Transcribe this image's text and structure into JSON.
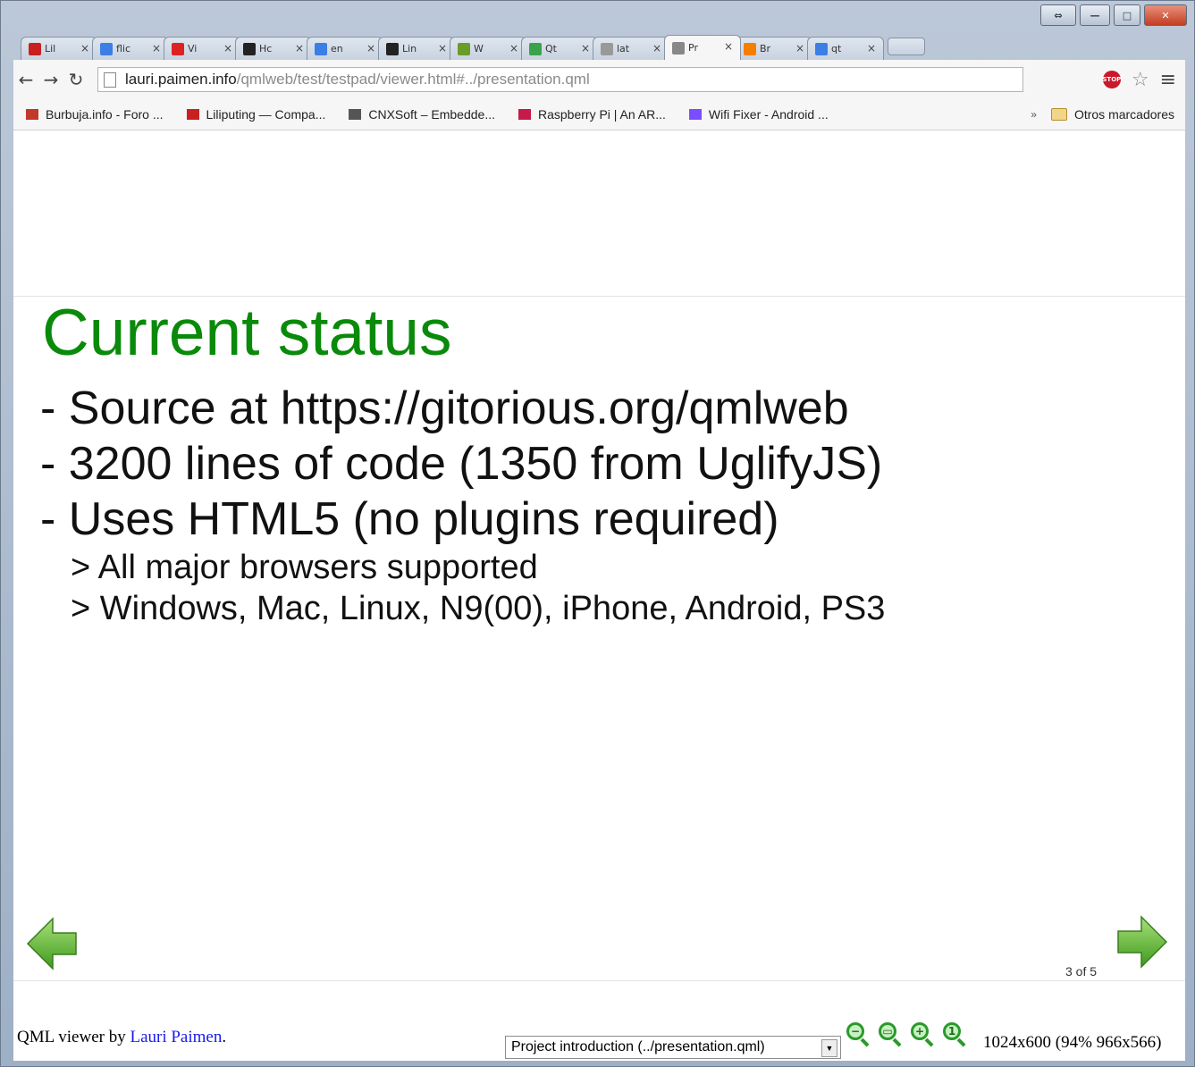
{
  "browser": {
    "tabs": [
      {
        "label": "Lil",
        "icon": "laptop-icon",
        "color": "#c8201e"
      },
      {
        "label": "flic",
        "icon": "google-plus-icon",
        "color": "#3a7ee6"
      },
      {
        "label": "Vi",
        "icon": "arc-icon",
        "color": "#d22"
      },
      {
        "label": "Hc",
        "icon": "github-icon",
        "color": "#222"
      },
      {
        "label": "en",
        "icon": "google-plus-icon",
        "color": "#3a7ee6"
      },
      {
        "label": "Lin",
        "icon": "github-icon",
        "color": "#222"
      },
      {
        "label": "W",
        "icon": "webos-icon",
        "color": "#6a9c28"
      },
      {
        "label": "Qt",
        "icon": "plus-box-icon",
        "color": "#3aa34a"
      },
      {
        "label": "lat",
        "icon": "spinner-icon",
        "color": "#999"
      },
      {
        "label": "Pr",
        "icon": "page-icon",
        "color": "#888",
        "active": true
      },
      {
        "label": "Br",
        "icon": "blogger-icon",
        "color": "#f57d00"
      },
      {
        "label": "qt",
        "icon": "google-plus-icon",
        "color": "#3a7ee6"
      }
    ],
    "url_host": "lauri.paimen.info",
    "url_path": "/qmlweb/test/testpad/viewer.html#../presentation.qml",
    "bookmarks": [
      {
        "label": "Burbuja.info - Foro ...",
        "icon": "burbuja-icon",
        "color": "#c0392b"
      },
      {
        "label": "Liliputing — Compa...",
        "icon": "laptop-icon",
        "color": "#c8201e"
      },
      {
        "label": "CNXSoft – Embedde...",
        "icon": "cnx-icon",
        "color": "#555"
      },
      {
        "label": "Raspberry Pi | An AR...",
        "icon": "raspberry-icon",
        "color": "#c51a4a"
      },
      {
        "label": "Wifi Fixer - Android ...",
        "icon": "play-store-icon",
        "color": "#7c4dff"
      }
    ],
    "bookmarks_overflow": "»",
    "other_bookmarks": "Otros marcadores",
    "stop_label": "STOP"
  },
  "slide": {
    "title": "Current status",
    "bullets": [
      "- Source at https://gitorious.org/qmlweb",
      "- 3200 lines of code (1350 from UglifyJS)",
      "- Uses HTML5 (no plugins required)"
    ],
    "subbullets": [
      "> All major browsers supported",
      "> Windows, Mac, Linux, N9(00), iPhone, Android, PS3"
    ],
    "counter": "3 of 5"
  },
  "footer": {
    "credit_prefix": "QML viewer by ",
    "credit_link": "Lauri Paimen",
    "credit_suffix": ".",
    "presentation_select": "Project introduction (../presentation.qml)",
    "resolution": "1024x600 (94% 966x566)"
  },
  "colors": {
    "title_green": "#0a8a0a",
    "link_blue": "#1a1aee"
  }
}
